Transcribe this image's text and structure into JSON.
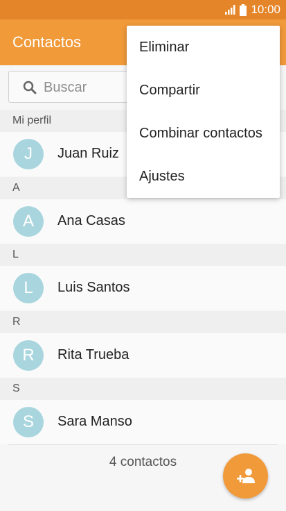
{
  "status_bar": {
    "time": "10:00",
    "signal_icon": "signal-icon",
    "battery_icon": "battery-icon"
  },
  "app_bar": {
    "title": "Contactos"
  },
  "search": {
    "placeholder": "Buscar",
    "icon": "search-icon"
  },
  "sections": [
    {
      "header": "Mi perfil",
      "contacts": [
        {
          "initial": "J",
          "name": "Juan Ruiz"
        }
      ]
    },
    {
      "header": "A",
      "contacts": [
        {
          "initial": "A",
          "name": "Ana Casas"
        }
      ]
    },
    {
      "header": "L",
      "contacts": [
        {
          "initial": "L",
          "name": "Luis Santos"
        }
      ]
    },
    {
      "header": "R",
      "contacts": [
        {
          "initial": "R",
          "name": "Rita Trueba"
        }
      ]
    },
    {
      "header": "S",
      "contacts": [
        {
          "initial": "S",
          "name": "Sara Manso"
        }
      ]
    }
  ],
  "footer": {
    "count_text": "4 contactos"
  },
  "fab": {
    "icon": "add-contact-icon"
  },
  "menu": {
    "items": [
      {
        "label": "Eliminar"
      },
      {
        "label": "Compartir"
      },
      {
        "label": "Combinar contactos"
      },
      {
        "label": "Ajustes"
      }
    ]
  },
  "colors": {
    "accent": "#f19a3a",
    "status_bar": "#e58529",
    "avatar": "#a9d6de"
  }
}
